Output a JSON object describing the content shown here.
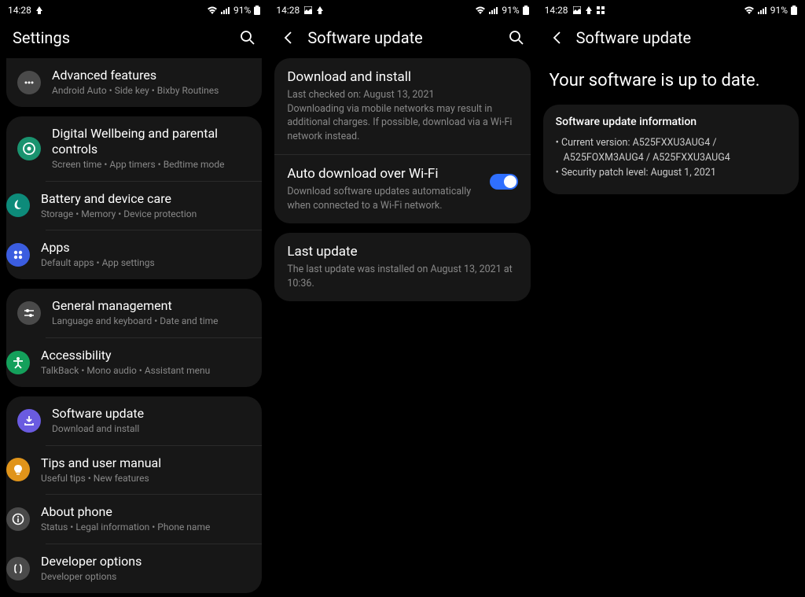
{
  "status": {
    "time": "14:28",
    "battery": "91%"
  },
  "screen1": {
    "title": "Settings",
    "groups": [
      {
        "partialTop": true,
        "rows": [
          {
            "icon": "ic-grey",
            "glyph": "dots",
            "title": "Advanced features",
            "sub": "Android Auto  •  Side key  •  Bixby Routines"
          }
        ]
      },
      {
        "rows": [
          {
            "icon": "ic-green",
            "glyph": "wellbeing",
            "title": "Digital Wellbeing and parental controls",
            "sub": "Screen time  •  App timers  •  Bedtime mode"
          },
          {
            "icon": "ic-teal",
            "glyph": "battery",
            "title": "Battery and device care",
            "sub": "Storage  •  Memory  •  Device protection"
          },
          {
            "icon": "ic-blue",
            "glyph": "apps",
            "title": "Apps",
            "sub": "Default apps  •  App settings"
          }
        ]
      },
      {
        "rows": [
          {
            "icon": "ic-grey",
            "glyph": "sliders",
            "title": "General management",
            "sub": "Language and keyboard  •  Date and time"
          },
          {
            "icon": "ic-green2",
            "glyph": "accessibility",
            "title": "Accessibility",
            "sub": "TalkBack  •  Mono audio  •  Assistant menu"
          }
        ]
      },
      {
        "rows": [
          {
            "icon": "ic-purple",
            "glyph": "update",
            "title": "Software update",
            "sub": "Download and install"
          },
          {
            "icon": "ic-orange",
            "glyph": "bulb",
            "title": "Tips and user manual",
            "sub": "Useful tips  •  New features"
          },
          {
            "icon": "ic-grey2",
            "glyph": "info",
            "title": "About phone",
            "sub": "Status  •  Legal information  •  Phone name"
          },
          {
            "icon": "ic-grey2",
            "glyph": "dev",
            "title": "Developer options",
            "sub": "Developer options"
          }
        ]
      }
    ]
  },
  "screen2": {
    "title": "Software update",
    "group1": [
      {
        "title": "Download and install",
        "sub": "Last checked on: August 13, 2021\nDownloading via mobile networks may result in additional charges. If possible, download via a Wi-Fi network instead."
      },
      {
        "title": "Auto download over Wi-Fi",
        "sub": "Download software updates automatically when connected to a Wi-Fi network.",
        "toggle": true
      }
    ],
    "group2": [
      {
        "title": "Last update",
        "sub": "The last update was installed on August 13, 2021 at 10:36."
      }
    ]
  },
  "screen3": {
    "title": "Software update",
    "headline": "Your software is up to date.",
    "infoTitle": "Software update information",
    "infoLines": [
      "Current version: A525FXXU3AUG4 / A525FOXM3AUG4 / A525FXXU3AUG4",
      "Security patch level: August 1, 2021"
    ]
  }
}
